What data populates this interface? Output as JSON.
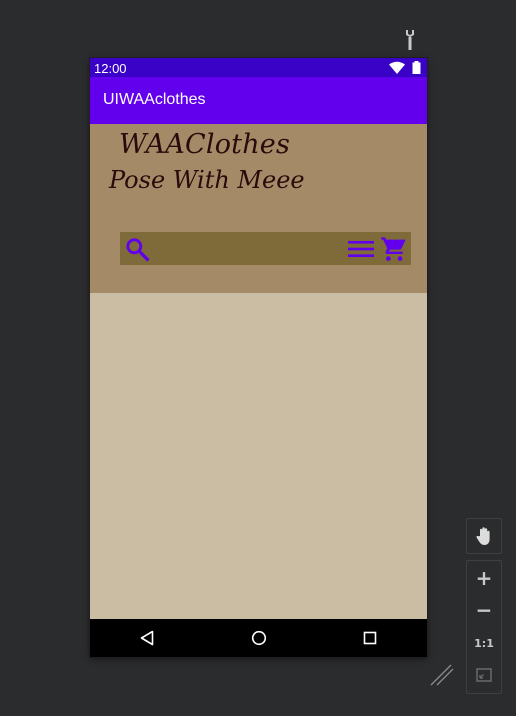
{
  "status_bar": {
    "time": "12:00",
    "icons": [
      "wifi-icon",
      "battery-icon"
    ]
  },
  "app_bar": {
    "title": "UIWAAclothes",
    "color": "#6200ee"
  },
  "header": {
    "brand_title": "WAAClothes",
    "tagline": "Pose With Meee",
    "background": "#a58a68",
    "toolbar_background": "#7f6b39",
    "toolbar_icons": [
      "search-icon",
      "menu-icon",
      "shopping-cart-icon"
    ],
    "icon_color": "#6200ee"
  },
  "content": {
    "background": "#cbbca4"
  },
  "nav_bar": {
    "buttons": [
      "back-icon",
      "home-icon",
      "recents-icon"
    ]
  },
  "emulator_controls": {
    "pan_tool": "hand-icon",
    "zoom_in": "+",
    "zoom_out": "−",
    "actual_size": "1:1",
    "fit_screen": "fit-screen-icon"
  }
}
